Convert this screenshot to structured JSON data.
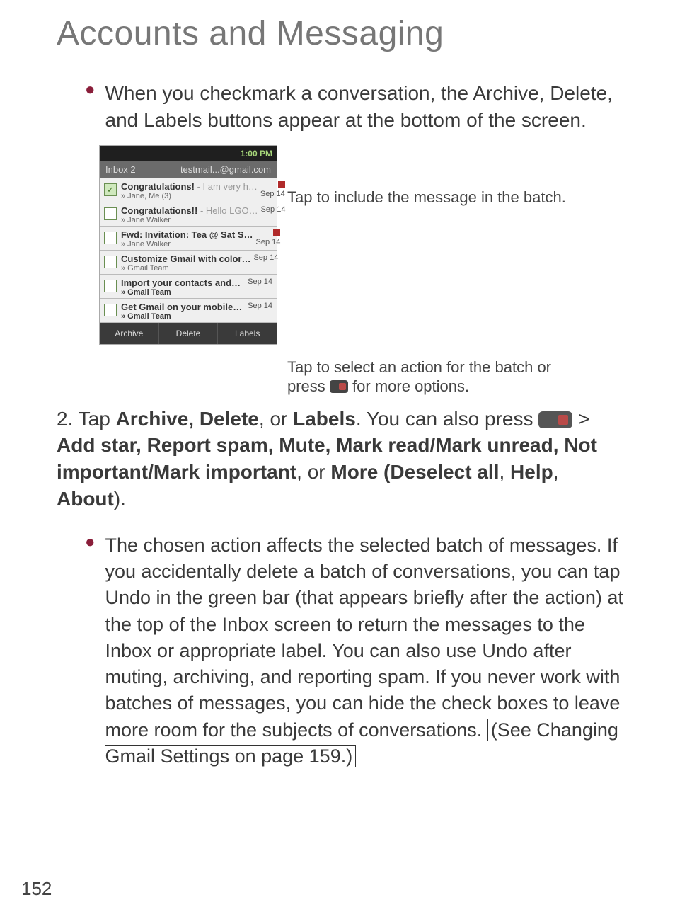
{
  "title": "Accounts and Messaging",
  "top_bullet": "When you checkmark a conversation, the Archive, Delete, and Labels buttons appear at the bottom of the screen.",
  "screenshot": {
    "status_time": "1:00 PM",
    "header_left": "Inbox 2",
    "header_right": "testmail...@gmail.com",
    "rows": [
      {
        "checked": true,
        "subject": "Congratulations!",
        "preview": " - I am very h…",
        "from": "Jane, Me (3)",
        "from_bold": false,
        "date": "Sep 14",
        "flag": true
      },
      {
        "checked": false,
        "subject": "Congratulations!!",
        "preview": " - Hello LGO…",
        "from": "Jane Walker",
        "from_bold": false,
        "date": "Sep 14",
        "flag": false
      },
      {
        "checked": false,
        "subject": "Fwd: Invitation: Tea @ Sat S…",
        "preview": "",
        "from": "Jane Walker",
        "from_bold": false,
        "date": "Sep 14",
        "flag": true
      },
      {
        "checked": false,
        "subject": "Customize Gmail with color…",
        "preview": "",
        "from": "Gmail Team",
        "from_bold": false,
        "date": "Sep 14",
        "flag": false
      },
      {
        "checked": false,
        "subject": "Import your contacts and…",
        "preview": "",
        "from": "Gmail Team",
        "from_bold": true,
        "date": "Sep 14",
        "flag": false
      },
      {
        "checked": false,
        "subject": "Get Gmail on your mobile…",
        "preview": "",
        "from": "Gmail Team",
        "from_bold": true,
        "date": "Sep 14",
        "flag": false
      }
    ],
    "actions": {
      "archive": "Archive",
      "delete": "Delete",
      "labels": "Labels"
    }
  },
  "callouts": {
    "top": "Tap to include the message in the batch.",
    "bottom_a": "Tap to select an action for the batch or",
    "bottom_b_pre": "press ",
    "bottom_b_post": " for more options."
  },
  "step2": {
    "prefix": "2. Tap ",
    "b1": "Archive, Delete",
    "mid1": ", or ",
    "b2": "Labels",
    "mid2": ". You can also press ",
    "gt": "  > ",
    "b3": "Add star, Report spam, Mute, Mark read/Mark unread, Not important/Mark important",
    "mid3": ", or ",
    "b4": "More (Deselect all",
    "mid4": ", ",
    "b5": "Help",
    "mid5": ", ",
    "b6": "About",
    "end": ")."
  },
  "sub_bullet": {
    "text_a": "The chosen action affects the selected batch of messages. If you accidentally delete a batch of conversations, you can tap Undo in the green bar (that appears briefly after the action) at the top of the Inbox screen to return the messages to the Inbox or appropriate label. You can also use Undo after muting, archiving, and reporting spam. If you never work with batches of messages, you can hide the check boxes to leave more room for the subjects of conversations. ",
    "link": "(See Changing Gmail Settings on page 159.)"
  },
  "page_number": "152"
}
